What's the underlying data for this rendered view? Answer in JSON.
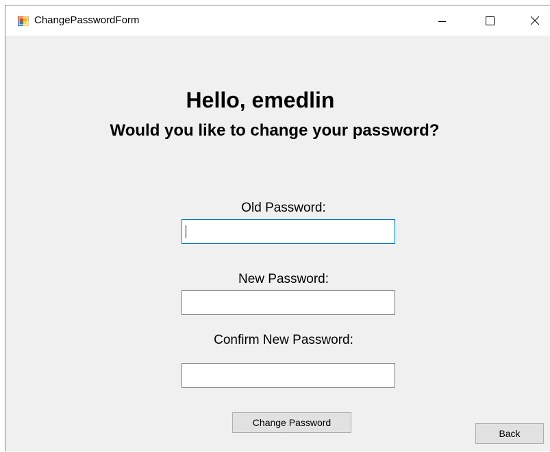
{
  "window": {
    "title": "ChangePasswordForm",
    "icon": "winforms-app-icon",
    "controls": [
      "minimize-icon",
      "maximize-icon",
      "close-icon"
    ]
  },
  "greeting": {
    "hello": "Hello, emedlin",
    "question": "Would you like to change your password?"
  },
  "fields": {
    "old_label": "Old Password:",
    "old_value": "",
    "new_label": "New Password:",
    "new_value": "",
    "confirm_label": "Confirm New Password:",
    "confirm_value": ""
  },
  "buttons": {
    "change_password": "Change Password",
    "back": "Back"
  },
  "colors": {
    "form_background": "#f0f0f0",
    "focus_border": "#0078d7",
    "button_face": "#e1e1e1"
  }
}
